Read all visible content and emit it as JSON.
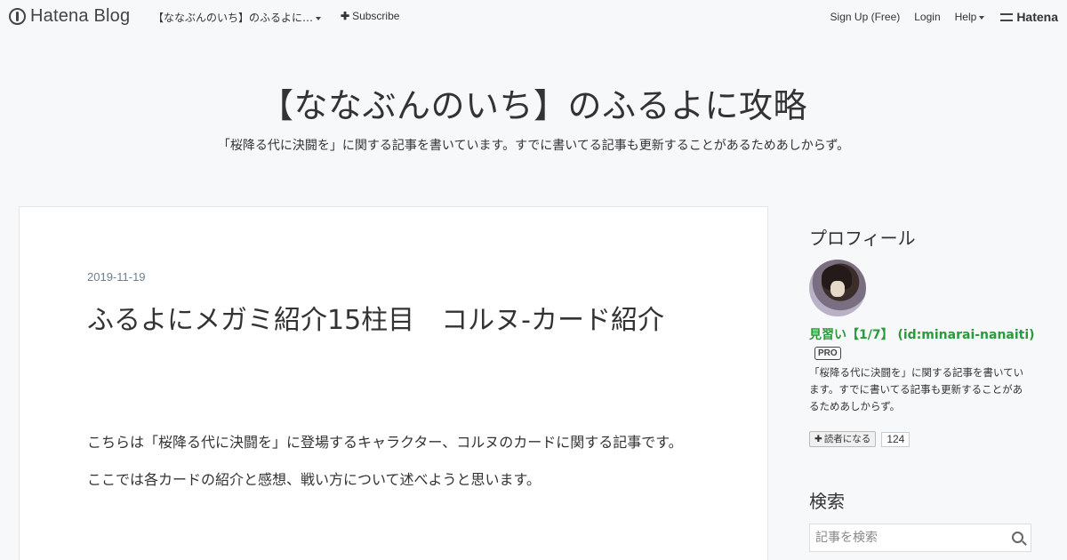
{
  "globalheader": {
    "logo_text": "Hatena Blog",
    "blog_menu": "【ななぶんのいち】のふるよに…",
    "subscribe": "Subscribe",
    "signup": "Sign Up (Free)",
    "login": "Login",
    "help": "Help",
    "hatena": "Hatena"
  },
  "blog": {
    "title": "【ななぶんのいち】のふるよに攻略",
    "description": "「桜降る代に決闘を」に関する記事を書いています。すでに書いてる記事も更新することがあるためあしからず。"
  },
  "entry": {
    "date": "2019-11-19",
    "title": "ふるよにメガミ紹介15柱目　コルヌ-カード紹介",
    "paragraphs": [
      "こちらは「桜降る代に決闘を」に登場するキャラクター、コルヌのカードに関する記事です。",
      "ここでは各カードの紹介と感想、戦い方について述べようと思います。"
    ]
  },
  "sidebar": {
    "profile_heading": "プロフィール",
    "profile_name": "見習い【1/7】 (id:minarai-nanaiti)",
    "pro_badge": "PRO",
    "profile_description": "「桜降る代に決闘を」に関する記事を書いています。すでに書いてる記事も更新することがあるためあしからず。",
    "reader_button": "読者になる",
    "reader_count": "124",
    "search_heading": "検索",
    "search_placeholder": "記事を検索"
  },
  "colors": {
    "background": "#f7f8f9",
    "profile_name": "#2a9a3c",
    "date": "#6d7e8c"
  }
}
